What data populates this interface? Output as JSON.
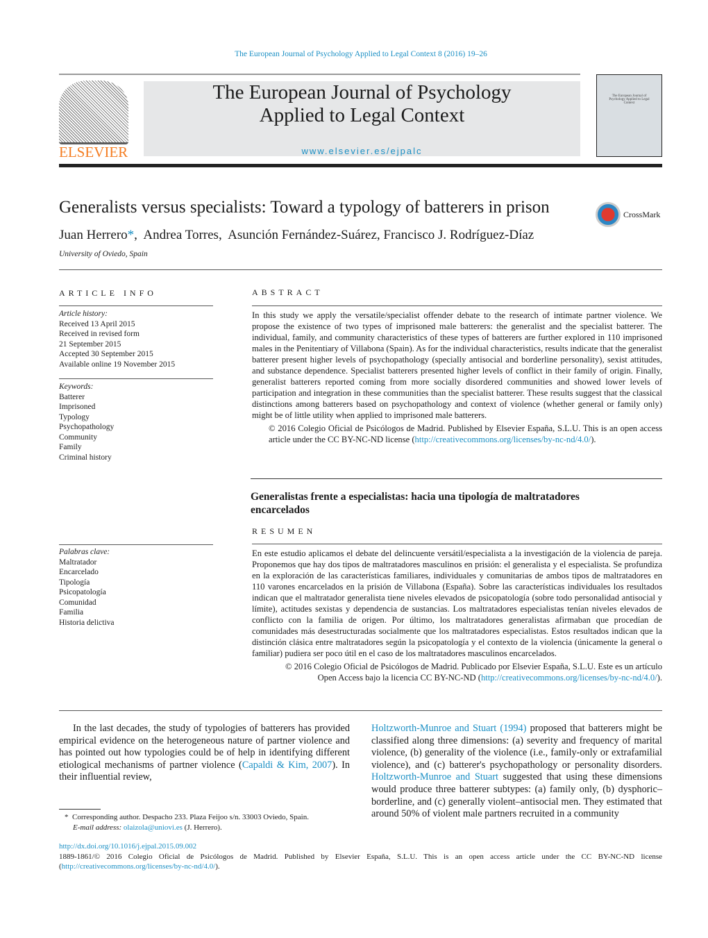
{
  "header": {
    "journal_ref": "The European Journal of Psychology Applied to Legal Context 8 (2016) 19–26",
    "publisher_logo": "ELSEVIER",
    "journal_title_line1": "The European Journal of Psychology",
    "journal_title_line2": "Applied to Legal Context",
    "url": "www.elsevier.es/ejpalc",
    "cover_text": "The European Journal of Psychology Applied to Legal Context"
  },
  "article": {
    "title": "Generalists versus specialists: Toward a typology of batterers in prison",
    "crossmark": "CrossMark",
    "authors": [
      "Juan Herrero",
      "Andrea Torres,",
      "Asunción Fernández-Suárez, Francisco J. Rodríguez-Díaz"
    ],
    "author_marker": "*",
    "affiliation": "University of Oviedo, Spain"
  },
  "article_info": {
    "heading": "ARTICLE INFO",
    "history_label": "Article history:",
    "history": [
      "Received 13 April 2015",
      "Received in revised form",
      "21 September 2015",
      "Accepted 30 September 2015",
      "Available online 19 November 2015"
    ],
    "keywords_label": "Keywords:",
    "keywords": [
      "Batterer",
      "Imprisoned",
      "Typology",
      "Psychopathology",
      "Community",
      "Family",
      "Criminal history"
    ],
    "palabras_label": "Palabras clave:",
    "palabras": [
      "Maltratador",
      "Encarcelado",
      "Tipología",
      "Psicopatología",
      "Comunidad",
      "Familia",
      "Historia delictiva"
    ]
  },
  "abstract": {
    "heading": "ABSTRACT",
    "text": "In this study we apply the versatile/specialist offender debate to the research of intimate partner violence. We propose the existence of two types of imprisoned male batterers: the generalist and the specialist batterer. The individual, family, and community characteristics of these types of batterers are further explored in 110 imprisoned males in the Penitentiary of Villabona (Spain). As for the individual characteristics, results indicate that the generalist batterer present higher levels of psychopathology (specially antisocial and borderline personality), sexist attitudes, and substance dependence. Specialist batterers presented higher levels of conflict in their family of origin. Finally, generalist batterers reported coming from more socially disordered communities and showed lower levels of participation and integration in these communities than the specialist batterer. These results suggest that the classical distinctions among batterers based on psychopathology and context of violence (whether general or family only) might be of little utility when applied to imprisoned male batterers.",
    "copyright": "© 2016 Colegio Oficial de Psicólogos de Madrid. Published by Elsevier España, S.L.U. This is an open access article under the CC BY-NC-ND license (",
    "license_url": "http://creativecommons.org/licenses/by-nc-nd/4.0/",
    "close": ")."
  },
  "resumen": {
    "spanish_title": "Generalistas frente a especialistas: hacia una tipología de maltratadores encarcelados",
    "heading": "RESUMEN",
    "text": "En este estudio aplicamos el debate del delincuente versátil/especialista a la investigación de la violencia de pareja. Proponemos que hay dos tipos de maltratadores masculinos en prisión: el generalista y el especialista. Se profundiza en la exploración de las características familiares, individuales y comunitarias de ambos tipos de maltratadores en 110 varones encarcelados en la prisión de Villabona (España). Sobre las características individuales los resultados indican que el maltratador generalista tiene niveles elevados de psicopatología (sobre todo personalidad antisocial y límite), actitudes sexistas y dependencia de sustancias. Los maltratadores especialistas tenían niveles elevados de conflicto con la familia de origen. Por último, los maltratadores generalistas afirmaban que procedían de comunidades más desestructuradas socialmente que los maltratadores especialistas. Estos resultados indican que la distinción clásica entre maltratadores según la psicopatología y el contexto de la violencia (únicamente la general o familiar) pudiera ser poco útil en el caso de los maltratadores masculinos encarcelados.",
    "copyright": "© 2016 Colegio Oficial de Psicólogos de Madrid. Publicado por Elsevier España, S.L.U. Este es un artículo Open Access bajo la licencia CC BY-NC-ND (",
    "license_url": "http://creativecommons.org/licenses/by-nc-nd/4.0/",
    "close": ")."
  },
  "body": {
    "col1_a": "In the last decades, the study of typologies of batterers has provided empirical evidence on the heterogeneous nature of partner violence and has pointed out how typologies could be of help in identifying different etiological mechanisms of partner violence (",
    "col1_cite": "Capaldi & Kim, 2007",
    "col1_b": "). In their influential review,",
    "col2_cite1": "Holtzworth-Munroe and Stuart (1994)",
    "col2_a": " proposed that batterers might be classified along three dimensions: (a) severity and frequency of marital violence, (b) generality of the violence (i.e., family-only or extrafamilial violence), and (c) batterer's psychopathology or personality disorders. ",
    "col2_cite2": "Holtzworth-Munroe and Stuart",
    "col2_b": " suggested that using these dimensions would produce three batterer subtypes: (a) family only, (b) dysphoric–borderline, and (c) generally violent–antisocial men. They estimated that around 50% of violent male partners recruited in a community"
  },
  "footnote": {
    "marker": "*",
    "text": "Corresponding author. Despacho 233. Plaza Feijoo s/n. 33003 Oviedo, Spain.",
    "email_label": "E-mail address:",
    "email": "olaizola@uniovi.es",
    "email_suffix": " (J. Herrero)."
  },
  "footer": {
    "doi": "http://dx.doi.org/10.1016/j.ejpal.2015.09.002",
    "copyright": "1889-1861/© 2016 Colegio Oficial de Psicólogos de Madrid. Published by Elsevier España, S.L.U. This is an open access article under the CC BY-NC-ND license (",
    "license_url": "http://creativecommons.org/licenses/by-nc-nd/4.0/",
    "close": ")."
  }
}
